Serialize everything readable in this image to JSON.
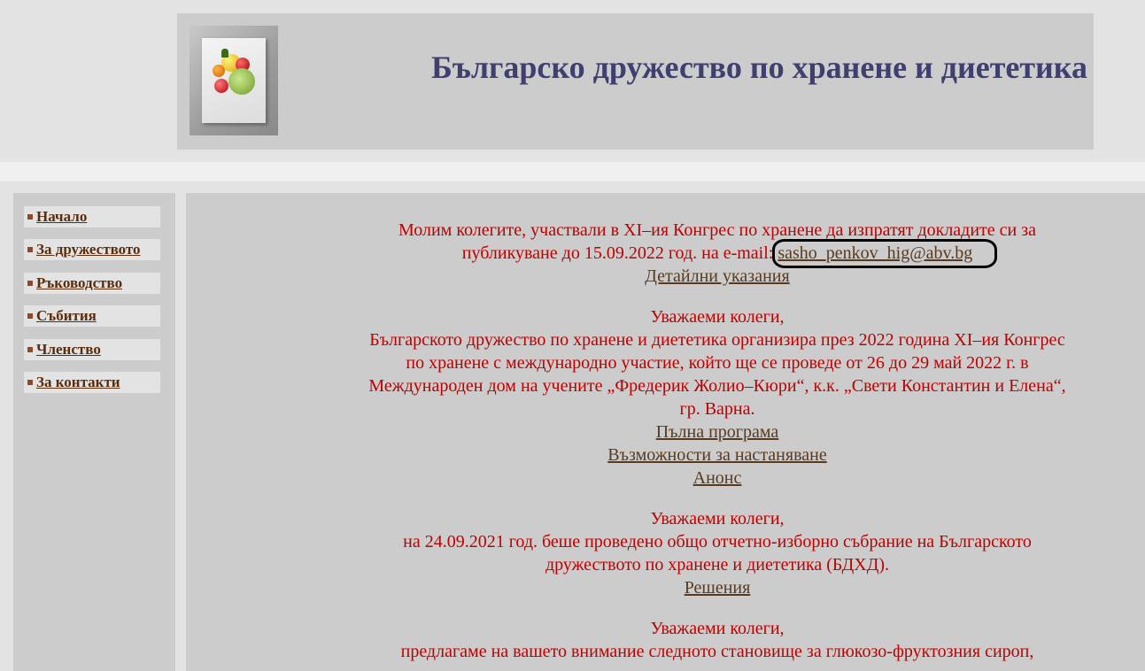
{
  "header": {
    "title": "Българско дружество по хранене и диететика"
  },
  "sidebar": {
    "items": [
      {
        "label": "Начало"
      },
      {
        "label": "За дружеството"
      },
      {
        "label": "Ръководство"
      },
      {
        "label": "Събития"
      },
      {
        "label": "Членство"
      },
      {
        "label": "За контакти"
      }
    ]
  },
  "content": {
    "notice1": {
      "line1": "Молим колегите, участвали в XI–ия Конгрес по хранене да изпратят докладите си за",
      "line2_prefix": "публикуване до 15.09.2022 год. на e-mail: ",
      "email": "sasho_penkov_hig@abv.bg",
      "link": "Детайлни указания"
    },
    "notice2": {
      "greeting": "Уважаеми колеги,",
      "line1": "Българското дружество по хранене и диететика организира през 2022 година XI–ия Конгрес",
      "line2": "по хранене с международно участие, който ще се проведе от 26 до 29 май 2022 г. в",
      "line3": "Международен дом на учените „Фредерик Жолио–Кюри“, к.к. „Свети Константин и Елена“,",
      "line4": "гр. Варна.",
      "link1": "Пълна програма",
      "link2": "Възможности за настаняване",
      "link3": "Анонс"
    },
    "notice3": {
      "greeting": "Уважаеми колеги,",
      "line1": "на 24.09.2021 год. беше проведено общо отчетно-изборно събрание на Българското",
      "line2": "дружеството по хранене и диететика (БДХД).",
      "link": "Решения"
    },
    "notice4": {
      "greeting": "Уважаеми колеги,",
      "line1": "предлагаме на вашето внимание следното становище за глюкозо-фруктозния сироп,"
    }
  },
  "colors": {
    "title": "#3f3f70",
    "notice_text": "#c00000",
    "link": "#5a3a1e",
    "nav_link": "#5a2d0c",
    "panel": "#cccccc",
    "background": "#e3e3e3"
  },
  "icons": {
    "logo": "fruit-bowl-logo",
    "nav_bullet": "square-bullet-icon"
  }
}
